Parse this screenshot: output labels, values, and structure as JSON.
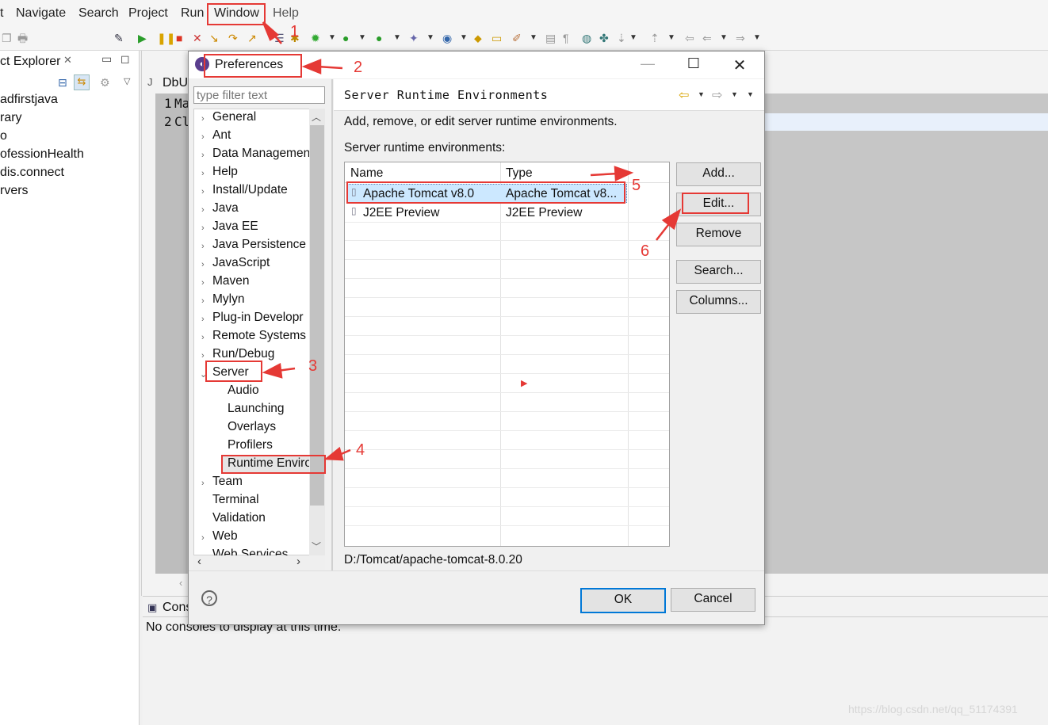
{
  "menu": [
    "t",
    "Navigate",
    "Search",
    "Project",
    "Run",
    "Window",
    "Help"
  ],
  "explorer": {
    "title": "ct Explorer",
    "items": [
      "adfirstjava",
      "rary",
      "o",
      "ofessionHealth",
      "dis.connect",
      "rvers"
    ]
  },
  "editor": {
    "tab_label": "DbU",
    "line1_num": "1",
    "line1_text": "Ma",
    "line2_num": "2",
    "line2_text": "Cl"
  },
  "console": {
    "tab_label": "Cons",
    "message": "No consoles to display at this time."
  },
  "dialog": {
    "title": "Preferences",
    "filter_placeholder": "type filter text",
    "tree": [
      "General",
      "Ant",
      "Data Managemen",
      "Help",
      "Install/Update",
      "Java",
      "Java EE",
      "Java Persistence",
      "JavaScript",
      "Maven",
      "Mylyn",
      "Plug-in Developr",
      "Remote Systems",
      "Run/Debug",
      "Server",
      "Audio",
      "Launching",
      "Overlays",
      "Profilers",
      "Runtime Enviro",
      "Team",
      "Terminal",
      "Validation",
      "Web",
      "Web Services"
    ],
    "page_title": "Server Runtime Environments",
    "description": "Add, remove, or edit server runtime environments.",
    "list_label": "Server runtime environments:",
    "columns": [
      "Name",
      "Type"
    ],
    "rows": [
      {
        "name": "Apache Tomcat v8.0",
        "type": "Apache Tomcat v8..."
      },
      {
        "name": "J2EE Preview",
        "type": "J2EE Preview"
      }
    ],
    "buttons": [
      "Add...",
      "Edit...",
      "Remove",
      "Search...",
      "Columns..."
    ],
    "path": "D:/Tomcat/apache-tomcat-8.0.20",
    "ok": "OK",
    "cancel": "Cancel"
  },
  "annotations": [
    "1",
    "2",
    "3",
    "4",
    "5",
    "6"
  ],
  "watermark": "https://blog.csdn.net/qq_51174391",
  "colors": {
    "annotation": "#e53935",
    "selection": "#cce8ff",
    "accent": "#0078d7"
  }
}
